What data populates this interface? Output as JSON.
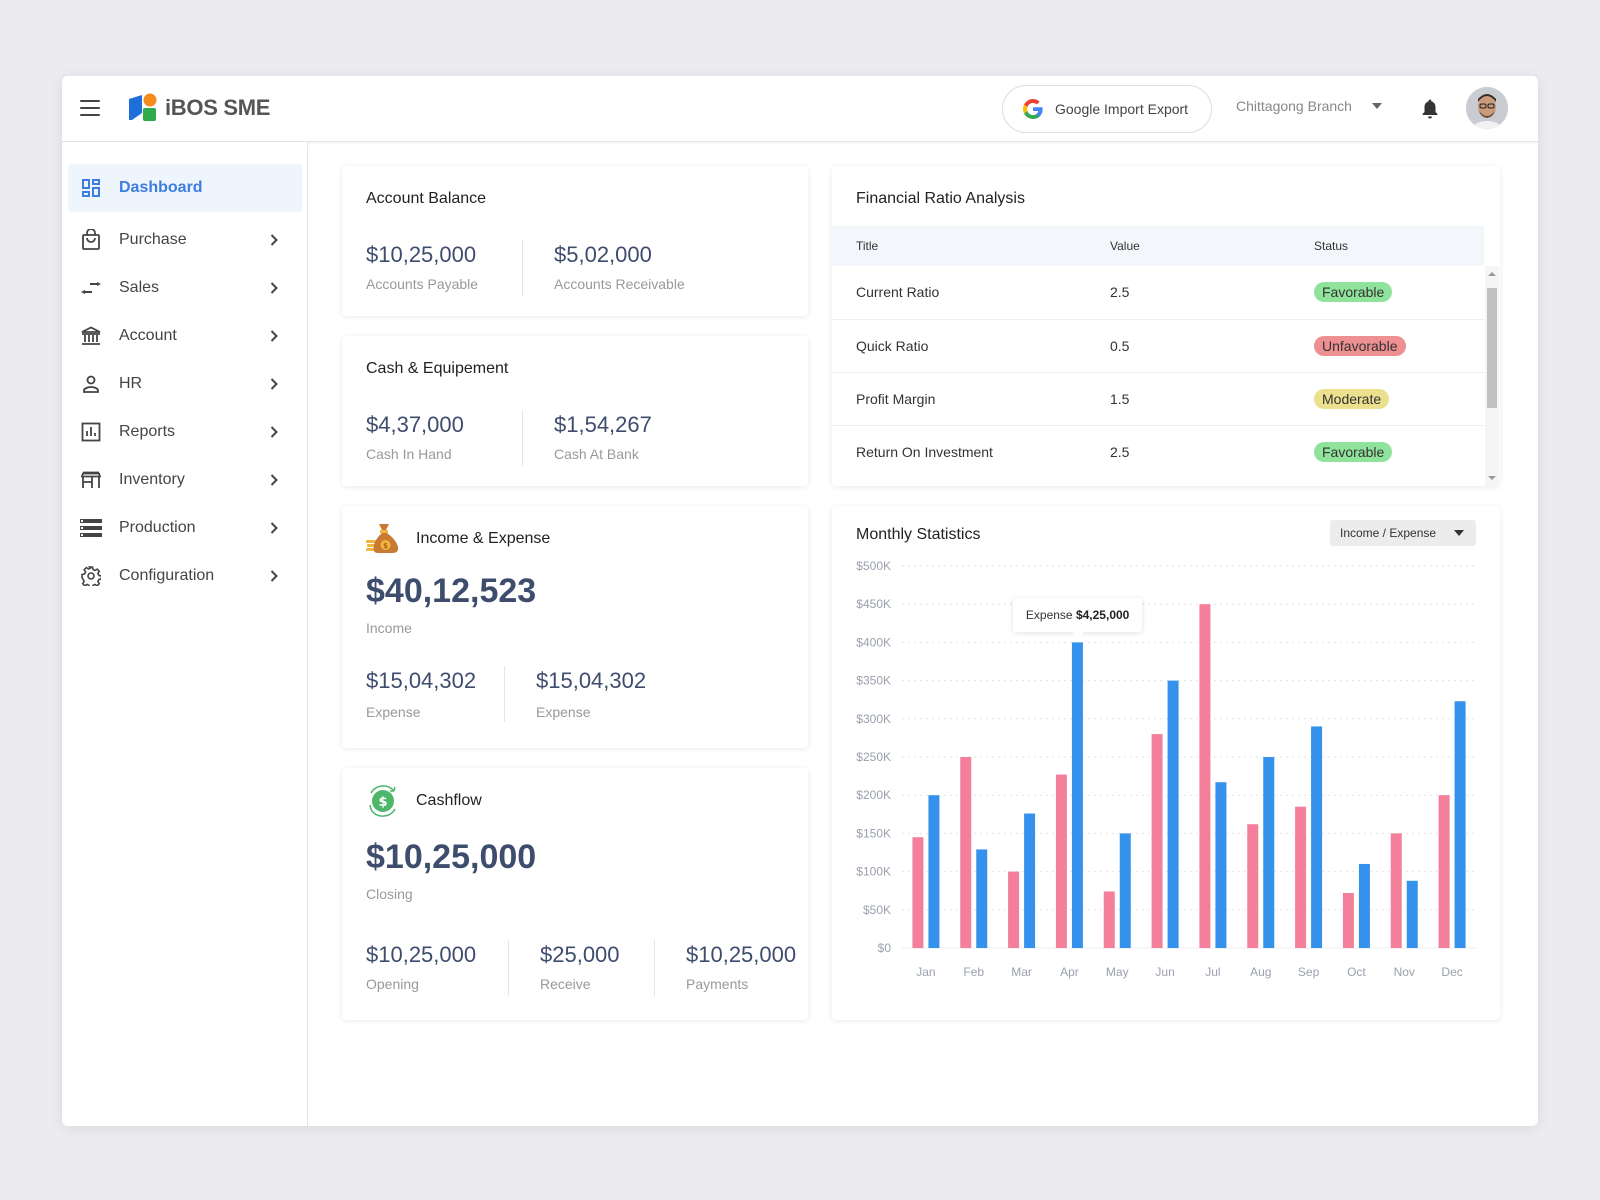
{
  "header": {
    "brand": "iBOS SME",
    "google_button": "Google Import Export",
    "branch": "Chittagong Branch",
    "icons": [
      "menu-icon",
      "logo-icon",
      "google-icon",
      "caret-down-icon",
      "bell-icon",
      "avatar"
    ]
  },
  "sidebar": {
    "items": [
      {
        "label": "Dashboard",
        "icon": "dashboard-icon",
        "active": true
      },
      {
        "label": "Purchase",
        "icon": "shopping-bag-icon"
      },
      {
        "label": "Sales",
        "icon": "swap-arrows-icon"
      },
      {
        "label": "Account",
        "icon": "bank-icon"
      },
      {
        "label": "HR",
        "icon": "person-icon"
      },
      {
        "label": "Reports",
        "icon": "bar-chart-icon"
      },
      {
        "label": "Inventory",
        "icon": "store-icon"
      },
      {
        "label": "Production",
        "icon": "list-stack-icon"
      },
      {
        "label": "Configuration",
        "icon": "gear-icon"
      }
    ]
  },
  "account_balance": {
    "title": "Account Balance",
    "items": [
      {
        "value": "$10,25,000",
        "label": "Accounts Payable"
      },
      {
        "value": "$5,02,000",
        "label": "Accounts Receivable"
      }
    ]
  },
  "cash_equipment": {
    "title": "Cash & Equipement",
    "items": [
      {
        "value": "$4,37,000",
        "label": "Cash In Hand"
      },
      {
        "value": "$1,54,267",
        "label": "Cash At Bank"
      }
    ]
  },
  "income_expense": {
    "title": "Income & Expense",
    "icon": "money-bag-icon",
    "main_value": "$40,12,523",
    "main_label": "Income",
    "items": [
      {
        "value": "$15,04,302",
        "label": "Expense"
      },
      {
        "value": "$15,04,302",
        "label": "Expense"
      }
    ]
  },
  "cashflow": {
    "title": "Cashflow",
    "icon": "dollar-cycle-icon",
    "main_value": "$10,25,000",
    "main_label": "Closing",
    "items": [
      {
        "value": "$10,25,000",
        "label": "Opening"
      },
      {
        "value": "$25,000",
        "label": "Receive"
      },
      {
        "value": "$10,25,000",
        "label": "Payments"
      }
    ]
  },
  "ratio": {
    "title": "Financial Ratio Analysis",
    "columns": [
      "Title",
      "Value",
      "Status"
    ],
    "rows": [
      {
        "title": "Current Ratio",
        "value": "2.5",
        "status": "Favorable",
        "color": "#90e39a"
      },
      {
        "title": "Quick Ratio",
        "value": "0.5",
        "status": "Unfavorable",
        "color": "#ee8f92"
      },
      {
        "title": "Profit Margin",
        "value": "1.5",
        "status": "Moderate",
        "color": "#ebe08d"
      },
      {
        "title": "Return On Investment",
        "value": "2.5",
        "status": "Favorable",
        "color": "#90e39a"
      }
    ]
  },
  "monthly": {
    "title": "Monthly Statistics",
    "dropdown": "Income / Expense",
    "tooltip": {
      "label": "Expense",
      "value": "$4,25,000",
      "month": "Apr"
    }
  },
  "chart_data": {
    "type": "bar",
    "title": "Monthly Statistics",
    "categories": [
      "Jan",
      "Feb",
      "Mar",
      "Apr",
      "May",
      "Jun",
      "Jul",
      "Aug",
      "Sep",
      "Oct",
      "Nov",
      "Dec"
    ],
    "series": [
      {
        "name": "Income",
        "color": "#f47f9b",
        "values": [
          145000,
          250000,
          100000,
          227000,
          74000,
          280000,
          450000,
          162000,
          185000,
          72000,
          150000,
          200000
        ]
      },
      {
        "name": "Expense",
        "color": "#3592ec",
        "values": [
          200000,
          129000,
          176000,
          400000,
          150000,
          350000,
          217000,
          250000,
          290000,
          110000,
          88000,
          323000
        ]
      }
    ],
    "ylim": [
      0,
      500000
    ],
    "yticks": [
      0,
      50000,
      100000,
      150000,
      200000,
      250000,
      300000,
      350000,
      400000,
      450000,
      500000
    ],
    "ytick_labels": [
      "$0",
      "$50K",
      "$100K",
      "$150K",
      "$200K",
      "$250K",
      "$300K",
      "$350K",
      "$400K",
      "$450K",
      "$500K"
    ],
    "grid": true,
    "xlabel": "",
    "ylabel": ""
  }
}
